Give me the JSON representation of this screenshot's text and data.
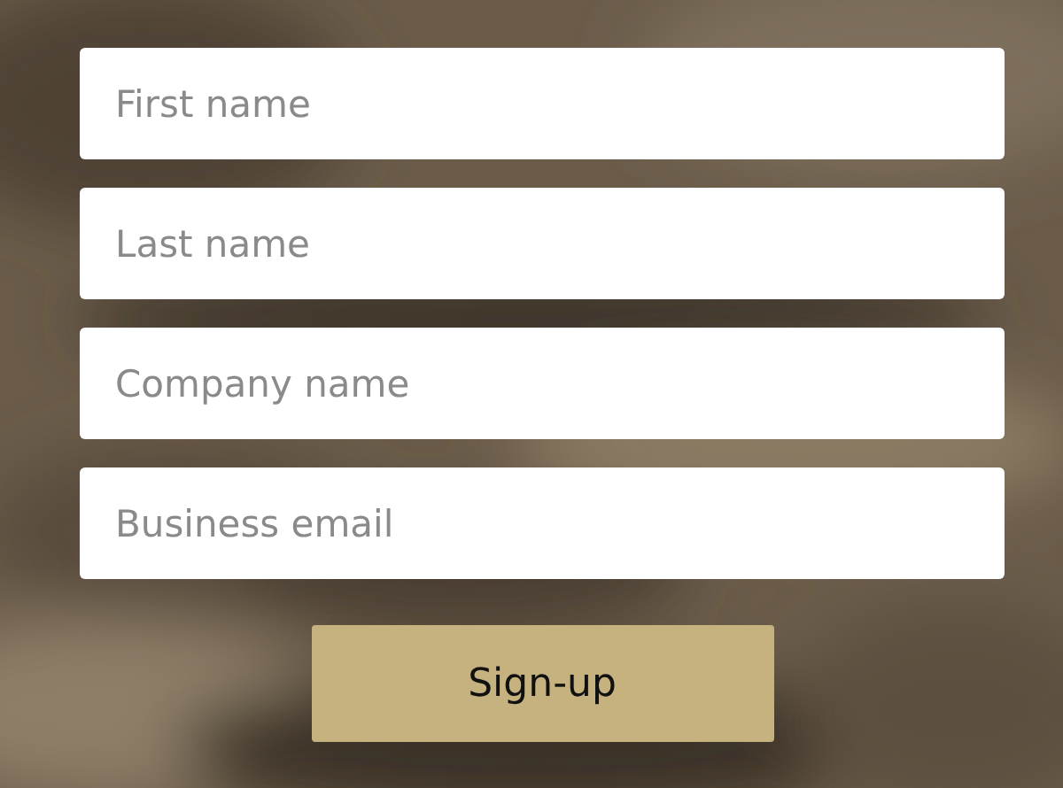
{
  "fields": [
    {
      "placeholder": "First name"
    },
    {
      "placeholder": "Last name"
    },
    {
      "placeholder": "Company name"
    },
    {
      "placeholder": "Business email"
    }
  ],
  "submit": {
    "label": "Sign-up"
  }
}
